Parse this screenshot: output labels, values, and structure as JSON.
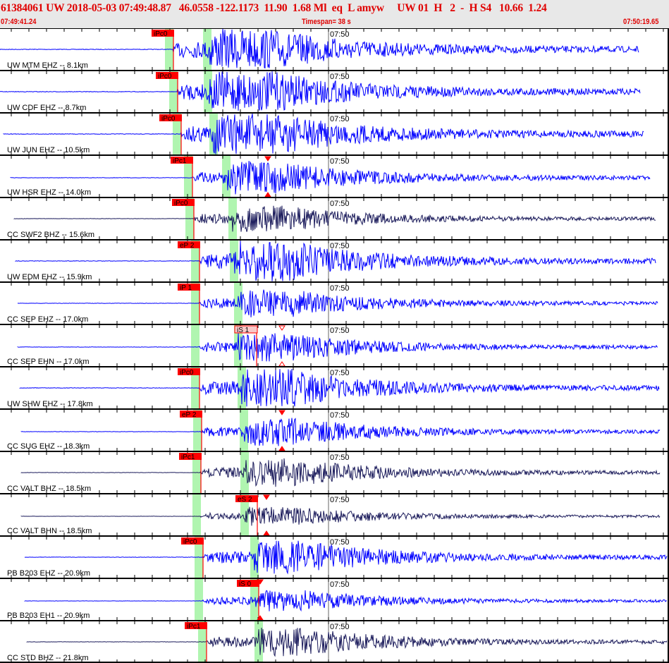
{
  "header": {
    "title": "61384061 UW 2018-05-03 07:49:48.87   46.0558 -122.1173  11.90  1.68 Ml  eq  L amyw     UW 01  H   2  -  H S4   10.66  1.24",
    "start_time": "07:49:41.24",
    "timespan": "Timespan=  38 s",
    "end_time": "07:50:19.65"
  },
  "minute_label": "07:50",
  "colors": {
    "broadband": "#1c1c5c",
    "short_period": "#0000ff",
    "pick": "#ff0000",
    "window": "#b0f5b0"
  },
  "channels": [
    {
      "label": "UW MTM EHZ -- 8.1km",
      "pick": "iPc0",
      "p": 246,
      "s": 294,
      "start": 0,
      "end": 906,
      "dark": false,
      "amp": 1.0
    },
    {
      "label": "UW CDF EHZ -- 8.7km",
      "pick": "iPc0",
      "p": 252,
      "s": 295,
      "start": 0,
      "end": 908,
      "dark": false,
      "amp": 1.0
    },
    {
      "label": "UW JUN EHZ -- 10.5km",
      "pick": "iPc0",
      "p": 257,
      "s": 303,
      "start": 5,
      "end": 913,
      "dark": false,
      "amp": 1.0
    },
    {
      "label": "UW HSR EHZ -- 14.0km",
      "pick": "iPc1",
      "p": 273,
      "s": 321,
      "start": 15,
      "end": 922,
      "dark": false,
      "amp": 0.7,
      "tri": 380
    },
    {
      "label": "CC SWF2 BHZ -- 15.6km",
      "pick": "iPc0",
      "p": 275,
      "s": 330,
      "start": 20,
      "end": 930,
      "dark": true,
      "amp": 0.55
    },
    {
      "label": "UW EDM EHZ -- 15.9km",
      "pick": "eP 2",
      "p": 283,
      "s": 332,
      "start": 22,
      "end": 930,
      "dark": false,
      "amp": 0.9
    },
    {
      "label": "CC SEP EHZ -- 17.0km",
      "pick": "iP 1",
      "p": 283,
      "s": 338,
      "start": 25,
      "end": 933,
      "dark": false,
      "amp": 0.6
    },
    {
      "label": "CC SEP EHN -- 17.0km",
      "pick": "iS 1",
      "p": 283,
      "s": 338,
      "start": 25,
      "end": 933,
      "dark": false,
      "amp": 0.6,
      "spick": 364,
      "tri": 400,
      "hollow": true
    },
    {
      "label": "UW SHW EHZ -- 17.8km",
      "pick": "iPc0",
      "p": 283,
      "s": 343,
      "start": 28,
      "end": 935,
      "dark": false,
      "amp": 0.8
    },
    {
      "label": "CC SUG EHZ -- 18.3km",
      "pick": "eP 2",
      "p": 286,
      "s": 346,
      "start": 30,
      "end": 936,
      "dark": false,
      "amp": 0.6,
      "tri": 400
    },
    {
      "label": "CC VALT BHZ -- 18.5km",
      "pick": "iPc1",
      "p": 285,
      "s": 347,
      "start": 30,
      "end": 936,
      "dark": true,
      "amp": 0.6
    },
    {
      "label": "CC VALT BHN -- 18.5km",
      "pick": "eS 2",
      "p": 285,
      "s": 347,
      "start": 30,
      "end": 936,
      "dark": true,
      "amp": 0.4,
      "spick": 365,
      "tri": 378
    },
    {
      "label": "PB B203 EHZ -- 20.9km",
      "pick": "iPc0",
      "p": 288,
      "s": 361,
      "start": 35,
      "end": 946,
      "dark": false,
      "amp": 0.7
    },
    {
      "label": "PB B203 EH1 -- 20.9km",
      "pick": "iS 0",
      "p": 288,
      "s": 361,
      "start": 35,
      "end": 946,
      "dark": false,
      "amp": 0.45,
      "spick": 367,
      "tri": 369
    },
    {
      "label": "CC STD BHZ -- 21.8km",
      "pick": "iPc1",
      "p": 293,
      "s": 367,
      "start": 38,
      "end": 946,
      "dark": true,
      "amp": 0.6
    }
  ]
}
